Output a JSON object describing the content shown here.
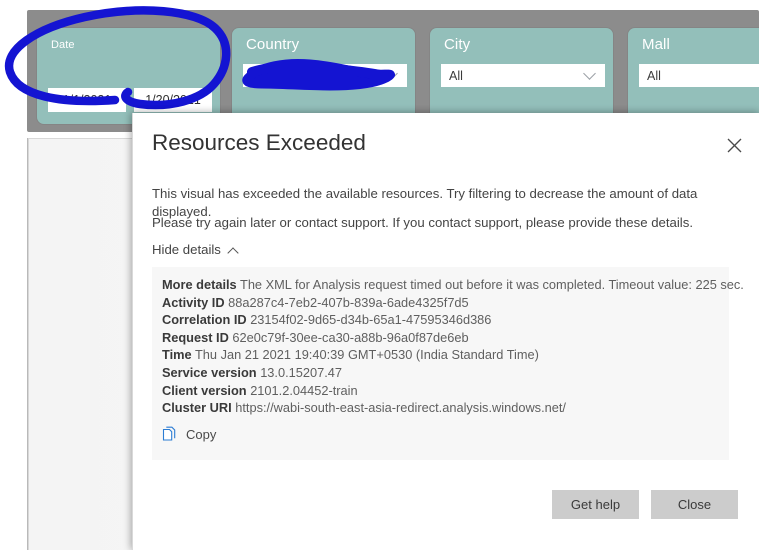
{
  "report": {
    "slicers": [
      {
        "name": "date",
        "title": "Date",
        "type": "date-range",
        "start": "1/1/2021",
        "end": "1/20/2021"
      },
      {
        "name": "country",
        "title": "Country",
        "type": "dropdown",
        "value": "",
        "redacted": true
      },
      {
        "name": "city",
        "title": "City",
        "type": "dropdown",
        "value": "All"
      },
      {
        "name": "mall",
        "title": "Mall",
        "type": "dropdown",
        "value": "All"
      }
    ]
  },
  "annotations": {
    "ink_color": "#1414d2",
    "marks": [
      {
        "name": "date-slicer-circle",
        "shape": "ellipse-loop"
      },
      {
        "name": "country-value-redaction",
        "shape": "scribble-blob"
      }
    ]
  },
  "dialog": {
    "title": "Resources Exceeded",
    "close_icon": "close-icon",
    "paragraph_1": "This visual has exceeded the available resources. Try filtering to decrease the amount of data displayed.",
    "paragraph_2": "Please try again later or contact support. If you contact support, please provide these details.",
    "toggle_details_label": "Hide details",
    "details": [
      {
        "key": "More details",
        "value": "The XML for Analysis request timed out before it was completed. Timeout value: 225 sec."
      },
      {
        "key": "Activity ID",
        "value": "88a287c4-7eb2-407b-839a-6ade4325f7d5"
      },
      {
        "key": "Correlation ID",
        "value": "23154f02-9d65-d34b-65a1-47595346d386"
      },
      {
        "key": "Request ID",
        "value": "62e0c79f-30ee-ca30-a88b-96a0f87de6eb"
      },
      {
        "key": "Time",
        "value": "Thu Jan 21 2021 19:40:39 GMT+0530 (India Standard Time)"
      },
      {
        "key": "Service version",
        "value": "13.0.15207.47"
      },
      {
        "key": "Client version",
        "value": "2101.2.04452-train"
      },
      {
        "key": "Cluster URI",
        "value": "https://wabi-south-east-asia-redirect.analysis.windows.net/"
      }
    ],
    "copy_label": "Copy",
    "copy_icon": "copy-icon",
    "buttons": {
      "get_help": "Get help",
      "close": "Close"
    }
  },
  "colors": {
    "slicer_teal": "#93bfba",
    "band_gray": "#8c8c8c",
    "ink_blue": "#1414d2",
    "button_gray": "#cccccc",
    "details_bg": "#f7f7f7"
  }
}
